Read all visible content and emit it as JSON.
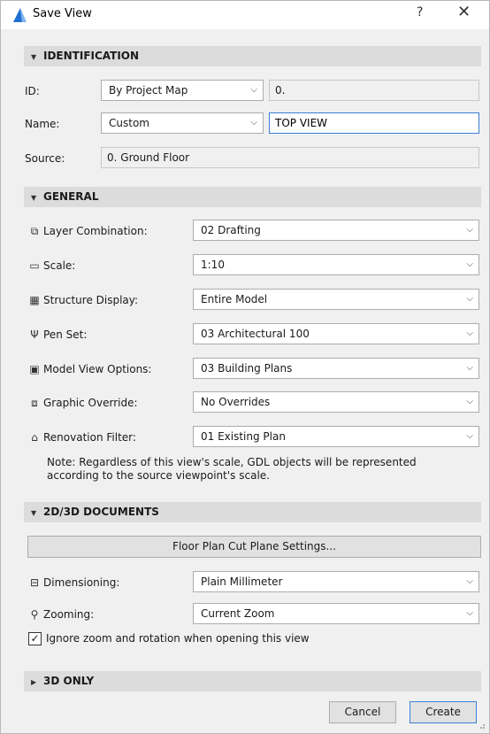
{
  "window": {
    "title": "Save View",
    "help_glyph": "?",
    "close_glyph": "✕"
  },
  "identification": {
    "header": "IDENTIFICATION",
    "id_label": "ID:",
    "id_mode": "By Project Map",
    "id_value": "0.",
    "name_label": "Name:",
    "name_mode": "Custom",
    "name_value": "TOP VIEW",
    "source_label": "Source:",
    "source_value": "0. Ground Floor"
  },
  "general": {
    "header": "GENERAL",
    "rows": [
      {
        "label": "Layer Combination:",
        "value": "02 Drafting",
        "icon": "layers-icon"
      },
      {
        "label": "Scale:",
        "value": "1:10",
        "icon": "scale-icon"
      },
      {
        "label": "Structure Display:",
        "value": "Entire Model",
        "icon": "structure-icon"
      },
      {
        "label": "Pen Set:",
        "value": "03 Architectural 100",
        "icon": "pen-icon"
      },
      {
        "label": "Model View Options:",
        "value": "03 Building Plans",
        "icon": "model-view-icon"
      },
      {
        "label": "Graphic Override:",
        "value": "No Overrides",
        "icon": "graphic-override-icon"
      },
      {
        "label": "Renovation Filter:",
        "value": "01 Existing Plan",
        "icon": "renovation-icon"
      }
    ],
    "note": "Note: Regardless of this view's scale, GDL objects will be represented according to the source viewpoint's scale."
  },
  "documents": {
    "header": "2D/3D DOCUMENTS",
    "cut_plane_button": "Floor Plan Cut Plane Settings...",
    "dimensioning_label": "Dimensioning:",
    "dimensioning_value": "Plain Millimeter",
    "zooming_label": "Zooming:",
    "zooming_value": "Current Zoom",
    "ignore_zoom_label": "Ignore zoom and rotation when opening this view",
    "ignore_zoom_checked": true
  },
  "three_d": {
    "header": "3D ONLY"
  },
  "footer": {
    "cancel_label": "Cancel",
    "create_label": "Create"
  },
  "colors": {
    "accent": "#3c7fd4",
    "section_bg": "#dcdcdc",
    "dialog_bg": "#f0f0f0"
  }
}
